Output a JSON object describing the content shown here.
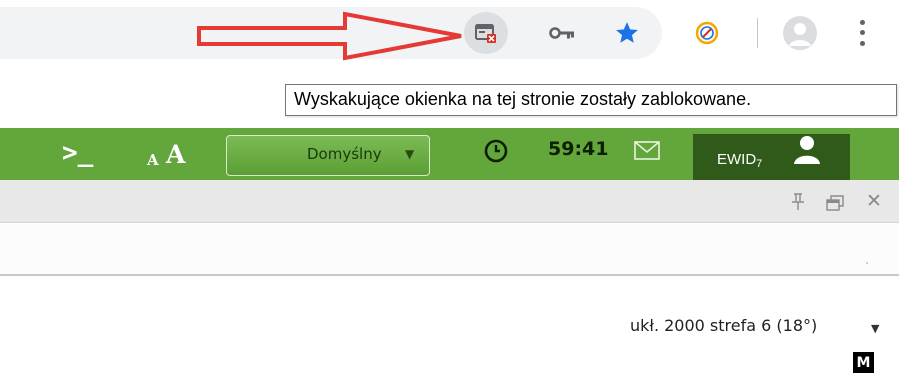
{
  "colors": {
    "app_green": "#63a63b",
    "user_box": "#2f5a1a",
    "annotation_red": "#e53935",
    "star_blue": "#1a73e8"
  },
  "browser_toolbar": {
    "icons": [
      "popup-blocked-icon",
      "key-icon",
      "bookmark-star-icon",
      "extension-icon",
      "profile-avatar-icon",
      "more-vert-icon"
    ]
  },
  "tooltip": {
    "text": "Wyskakujące okienka na tej stronie zostały zablokowane."
  },
  "app_header": {
    "theme_select": "Domyślny",
    "timer": "59:41",
    "user": "EWID7"
  },
  "map_status": {
    "crs_label": "ukł. 2000 strefa 6 (18°)",
    "badge": "M"
  }
}
